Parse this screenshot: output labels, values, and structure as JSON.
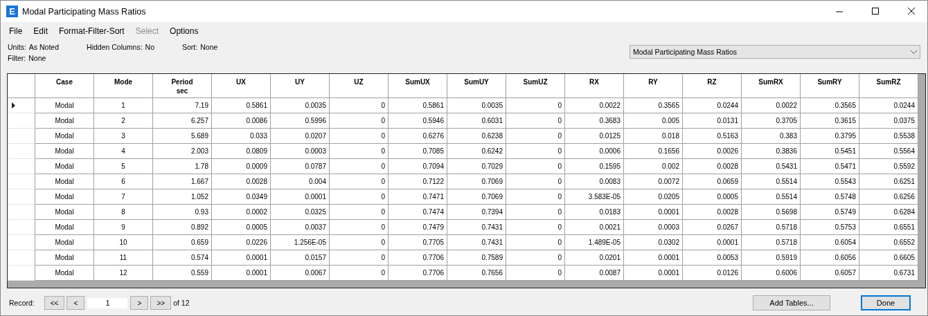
{
  "window": {
    "title": "Modal Participating Mass Ratios",
    "app_icon": "E"
  },
  "menu": [
    {
      "label": "File",
      "disabled": false
    },
    {
      "label": "Edit",
      "disabled": false
    },
    {
      "label": "Format-Filter-Sort",
      "disabled": false
    },
    {
      "label": "Select",
      "disabled": true
    },
    {
      "label": "Options",
      "disabled": false
    }
  ],
  "info": {
    "units_label": "Units:",
    "units": "As Noted",
    "hidden_label": "Hidden Columns:",
    "hidden": "No",
    "sort_label": "Sort:",
    "sort": "None",
    "filter_label": "Filter:",
    "filter": "None"
  },
  "table_select": {
    "value": "Modal Participating Mass Ratios"
  },
  "table": {
    "columns": [
      {
        "label": "Case"
      },
      {
        "label": "Mode"
      },
      {
        "label": "Period",
        "unit": "sec"
      },
      {
        "label": "UX"
      },
      {
        "label": "UY"
      },
      {
        "label": "UZ"
      },
      {
        "label": "SumUX"
      },
      {
        "label": "SumUY"
      },
      {
        "label": "SumUZ"
      },
      {
        "label": "RX"
      },
      {
        "label": "RY"
      },
      {
        "label": "RZ"
      },
      {
        "label": "SumRX"
      },
      {
        "label": "SumRY"
      },
      {
        "label": "SumRZ"
      }
    ],
    "rows": [
      {
        "selected": true,
        "cells": [
          "Modal",
          "1",
          "7.19",
          "0.5861",
          "0.0035",
          "0",
          "0.5861",
          "0.0035",
          "0",
          "0.0022",
          "0.3565",
          "0.0244",
          "0.0022",
          "0.3565",
          "0.0244"
        ]
      },
      {
        "selected": false,
        "cells": [
          "Modal",
          "2",
          "6.257",
          "0.0086",
          "0.5996",
          "0",
          "0.5946",
          "0.6031",
          "0",
          "0.3683",
          "0.005",
          "0.0131",
          "0.3705",
          "0.3615",
          "0.0375"
        ]
      },
      {
        "selected": false,
        "cells": [
          "Modal",
          "3",
          "5.689",
          "0.033",
          "0.0207",
          "0",
          "0.6276",
          "0.6238",
          "0",
          "0.0125",
          "0.018",
          "0.5163",
          "0.383",
          "0.3795",
          "0.5538"
        ]
      },
      {
        "selected": false,
        "cells": [
          "Modal",
          "4",
          "2.003",
          "0.0809",
          "0.0003",
          "0",
          "0.7085",
          "0.6242",
          "0",
          "0.0006",
          "0.1656",
          "0.0026",
          "0.3836",
          "0.5451",
          "0.5564"
        ]
      },
      {
        "selected": false,
        "cells": [
          "Modal",
          "5",
          "1.78",
          "0.0009",
          "0.0787",
          "0",
          "0.7094",
          "0.7029",
          "0",
          "0.1595",
          "0.002",
          "0.0028",
          "0.5431",
          "0.5471",
          "0.5592"
        ]
      },
      {
        "selected": false,
        "cells": [
          "Modal",
          "6",
          "1.667",
          "0.0028",
          "0.004",
          "0",
          "0.7122",
          "0.7069",
          "0",
          "0.0083",
          "0.0072",
          "0.0659",
          "0.5514",
          "0.5543",
          "0.6251"
        ]
      },
      {
        "selected": false,
        "cells": [
          "Modal",
          "7",
          "1.052",
          "0.0349",
          "0.0001",
          "0",
          "0.7471",
          "0.7069",
          "0",
          "3.583E-05",
          "0.0205",
          "0.0005",
          "0.5514",
          "0.5748",
          "0.6256"
        ]
      },
      {
        "selected": false,
        "cells": [
          "Modal",
          "8",
          "0.93",
          "0.0002",
          "0.0325",
          "0",
          "0.7474",
          "0.7394",
          "0",
          "0.0183",
          "0.0001",
          "0.0028",
          "0.5698",
          "0.5749",
          "0.6284"
        ]
      },
      {
        "selected": false,
        "cells": [
          "Modal",
          "9",
          "0.892",
          "0.0005",
          "0.0037",
          "0",
          "0.7479",
          "0.7431",
          "0",
          "0.0021",
          "0.0003",
          "0.0267",
          "0.5718",
          "0.5753",
          "0.6551"
        ]
      },
      {
        "selected": false,
        "cells": [
          "Modal",
          "10",
          "0.659",
          "0.0226",
          "1.256E-05",
          "0",
          "0.7705",
          "0.7431",
          "0",
          "1.489E-05",
          "0.0302",
          "0.0001",
          "0.5718",
          "0.6054",
          "0.6552"
        ]
      },
      {
        "selected": false,
        "cells": [
          "Modal",
          "11",
          "0.574",
          "0.0001",
          "0.0157",
          "0",
          "0.7706",
          "0.7589",
          "0",
          "0.0201",
          "0.0001",
          "0.0053",
          "0.5919",
          "0.6056",
          "0.6605"
        ]
      },
      {
        "selected": false,
        "cells": [
          "Modal",
          "12",
          "0.559",
          "0.0001",
          "0.0067",
          "0",
          "0.7706",
          "0.7656",
          "0",
          "0.0087",
          "0.0001",
          "0.0126",
          "0.6006",
          "0.6057",
          "0.6731"
        ]
      }
    ]
  },
  "footer": {
    "record_label": "Record:",
    "nav": [
      "<<",
      "<",
      ">",
      ">>"
    ],
    "record": "1",
    "of": "of 12",
    "buttons": [
      {
        "label": "Add Tables...",
        "focused": false
      },
      {
        "label": "Done",
        "focused": true
      }
    ]
  }
}
